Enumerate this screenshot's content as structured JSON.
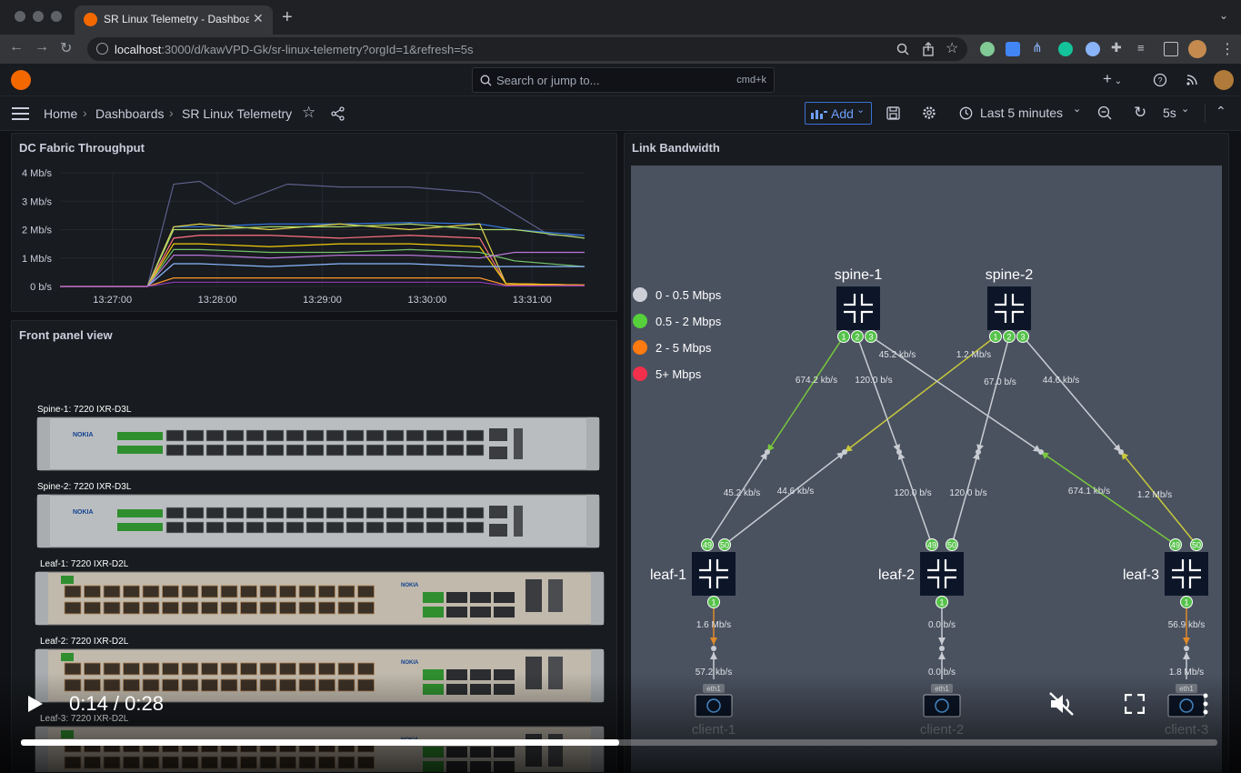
{
  "browser": {
    "tab_title": "SR Linux Telemetry - Dashboard",
    "tab_close": "✕",
    "new_tab": "+",
    "url_host": "localhost",
    "url_path": ":3000/d/kawVPD-Gk/sr-linux-telemetry?orgId=1&refresh=5s"
  },
  "topnav": {
    "search_placeholder": "Search or jump to...",
    "search_shortcut": "cmd+k",
    "plus": "+"
  },
  "breadcrumb": {
    "home": "Home",
    "dashboards": "Dashboards",
    "current": "SR Linux Telemetry"
  },
  "toolbar": {
    "add_label": "Add",
    "time_range": "Last 5 minutes",
    "refresh_interval": "5s"
  },
  "throughput_panel": {
    "title": "DC Fabric Throughput"
  },
  "chart_data": {
    "type": "line",
    "title": "DC Fabric Throughput",
    "y_ticks": [
      "0 b/s",
      "1 Mb/s",
      "2 Mb/s",
      "3 Mb/s",
      "4 Mb/s"
    ],
    "x_ticks": [
      "13:27:00",
      "13:28:00",
      "13:29:00",
      "13:30:00",
      "13:31:00"
    ],
    "ylim": [
      0,
      4
    ],
    "xlim": [
      0,
      300
    ],
    "grid": true,
    "series": [
      {
        "color": "#5d5f8c",
        "x": [
          0,
          50,
          65,
          80,
          100,
          130,
          160,
          200,
          240,
          280,
          300
        ],
        "y": [
          0,
          0,
          3.6,
          3.7,
          2.9,
          3.6,
          3.5,
          3.5,
          3.3,
          1.8,
          1.8
        ]
      },
      {
        "color": "#3274d9",
        "x": [
          0,
          50,
          65,
          80,
          120,
          160,
          200,
          240,
          260,
          300
        ],
        "y": [
          0,
          0,
          2.1,
          2.1,
          2.2,
          2.2,
          2.25,
          2.2,
          2.0,
          1.8
        ]
      },
      {
        "color": "#e0d44a",
        "x": [
          0,
          50,
          65,
          80,
          120,
          160,
          200,
          240,
          255,
          300
        ],
        "y": [
          0,
          0,
          2.1,
          2.2,
          2.0,
          2.2,
          2.0,
          2.2,
          0.1,
          0.05
        ]
      },
      {
        "color": "#a9d86e",
        "x": [
          0,
          50,
          65,
          80,
          120,
          160,
          200,
          240,
          260,
          300
        ],
        "y": [
          0,
          0,
          2.0,
          2.0,
          2.1,
          2.1,
          2.2,
          2.0,
          2.0,
          1.7
        ]
      },
      {
        "color": "#ff7383",
        "x": [
          0,
          50,
          65,
          80,
          120,
          160,
          200,
          240,
          255,
          300
        ],
        "y": [
          0,
          0,
          1.7,
          1.8,
          1.8,
          1.7,
          1.8,
          1.7,
          0.1,
          0.05
        ]
      },
      {
        "color": "#f2cc0c",
        "x": [
          0,
          50,
          65,
          80,
          120,
          160,
          200,
          240,
          255,
          300
        ],
        "y": [
          0,
          0,
          1.5,
          1.5,
          1.4,
          1.5,
          1.5,
          1.4,
          0.1,
          0.05
        ]
      },
      {
        "color": "#73bf69",
        "x": [
          0,
          50,
          65,
          80,
          120,
          160,
          200,
          240,
          260,
          300
        ],
        "y": [
          0,
          0,
          1.3,
          1.3,
          1.2,
          1.2,
          1.3,
          1.2,
          0.9,
          0.7
        ]
      },
      {
        "color": "#b877d9",
        "x": [
          0,
          50,
          65,
          80,
          120,
          160,
          200,
          240,
          260,
          300
        ],
        "y": [
          0,
          0,
          1.1,
          1.1,
          1.0,
          1.1,
          1.1,
          1.0,
          1.2,
          1.2
        ]
      },
      {
        "color": "#8ab8ff",
        "x": [
          0,
          50,
          65,
          80,
          120,
          160,
          200,
          240,
          260,
          300
        ],
        "y": [
          0,
          0,
          0.8,
          0.8,
          0.7,
          0.8,
          0.8,
          0.7,
          0.7,
          0.7
        ]
      },
      {
        "color": "#ff9830",
        "x": [
          0,
          50,
          65,
          80,
          120,
          160,
          200,
          240,
          255,
          300
        ],
        "y": [
          0,
          0,
          0.3,
          0.3,
          0.3,
          0.3,
          0.3,
          0.3,
          0.05,
          0.05
        ]
      },
      {
        "color": "#8f3bb8",
        "x": [
          0,
          50,
          65,
          80,
          120,
          160,
          200,
          240,
          255,
          300
        ],
        "y": [
          0,
          0,
          0.15,
          0.15,
          0.15,
          0.15,
          0.15,
          0.15,
          0.02,
          0.02
        ]
      }
    ]
  },
  "front_panel": {
    "title": "Front panel view",
    "devices": [
      {
        "label": "Spine-1: 7220 IXR-D3L",
        "brand": "NOKIA",
        "kind": "d3l"
      },
      {
        "label": "Spine-2: 7220 IXR-D3L",
        "brand": "NOKIA",
        "kind": "d3l"
      },
      {
        "label": "Leaf-1: 7220 IXR-D2L",
        "brand": "NOKIA",
        "kind": "d2l"
      },
      {
        "label": "Leaf-2: 7220 IXR-D2L",
        "brand": "NOKIA",
        "kind": "d2l"
      },
      {
        "label": "Leaf-3: 7220 IXR-D2L",
        "brand": "NOKIA",
        "kind": "d2l"
      }
    ]
  },
  "link_panel": {
    "title": "Link Bandwidth",
    "legend": [
      {
        "label": "0 - 0.5 Mbps",
        "color": "#cdd0d6"
      },
      {
        "label": "0.5 - 2 Mbps",
        "color": "#56d13b"
      },
      {
        "label": "2 - 5 Mbps",
        "color": "#ff7a10"
      },
      {
        "label": "5+ Mbps",
        "color": "#f2304c"
      }
    ],
    "nodes": {
      "spine1": {
        "name": "spine-1",
        "ports": [
          "1",
          "2",
          "3"
        ]
      },
      "spine2": {
        "name": "spine-2",
        "ports": [
          "1",
          "2",
          "3"
        ]
      },
      "leaf1": {
        "name": "leaf-1",
        "up_ports": [
          "49",
          "50"
        ],
        "down_port": "1"
      },
      "leaf2": {
        "name": "leaf-2",
        "up_ports": [
          "49",
          "50"
        ],
        "down_port": "1"
      },
      "leaf3": {
        "name": "leaf-3",
        "up_ports": [
          "49",
          "50"
        ],
        "down_port": "1"
      },
      "client1": {
        "name": "client-1",
        "iface": "eth1"
      },
      "client2": {
        "name": "client-2",
        "iface": "eth1"
      },
      "client3": {
        "name": "client-3",
        "iface": "eth1"
      }
    },
    "rates": {
      "s1_l1": "674.2 kb/s",
      "s1_l2": "120.0 b/s",
      "s1_l3": "45.2 kb/s",
      "s2_l1": "1.2 Mb/s",
      "s2_l2": "67.0 b/s",
      "s2_l3": "44.6 kb/s",
      "l1_s1": "45.2 kb/s",
      "l1_s2": "44.6 kb/s",
      "l2_s1": "120.0 b/s",
      "l2_s2": "120.0 b/s",
      "l3_s1": "674.1 kb/s",
      "l3_s2": "1.2 Mb/s",
      "l1_c1": "1.6 Mb/s",
      "c1_l1": "57.2 kb/s",
      "l2_c2": "0.0 b/s",
      "c2_l2": "0.0 b/s",
      "l3_c3": "56.9 kb/s",
      "c3_l3": "1.8 Mb/s"
    }
  },
  "video": {
    "time": "0:14 / 0:28",
    "progress": 0.5
  }
}
